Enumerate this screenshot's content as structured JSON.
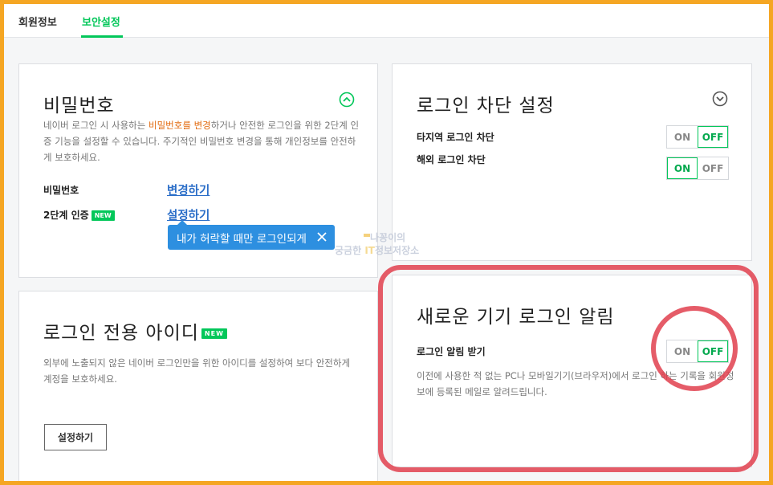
{
  "tabs": {
    "member_info": "회원정보",
    "security": "보안설정"
  },
  "password_card": {
    "title": "비밀번호",
    "desc_pre": "네이버 로그인 시 사용하는 ",
    "desc_highlight": "비밀번호를 변경",
    "desc_post": "하거나 안전한 로그인을 위한 2단계 인증 기능을 설정할 수 있습니다. 주기적인 비밀번호 변경을 통해 개인정보를 안전하게 보호하세요.",
    "rows": [
      {
        "label": "비밀번호",
        "action": "변경하기"
      },
      {
        "label": "2단계 인증",
        "badge": "NEW",
        "action": "설정하기"
      }
    ],
    "tooltip": "내가 허락할 때만 로그인되게",
    "collapse_icon": "chevron-up-circle-icon"
  },
  "block_card": {
    "title": "로그인 차단 설정",
    "expand_icon": "chevron-down-circle-icon",
    "rows": [
      {
        "label": "타지역 로그인 차단",
        "on": "ON",
        "off": "OFF",
        "state": "OFF"
      },
      {
        "label": "해외 로그인 차단",
        "on": "ON",
        "off": "OFF",
        "state": "ON"
      }
    ]
  },
  "id_card": {
    "title": "로그인 전용 아이디",
    "badge": "NEW",
    "desc": "외부에 노출되지 않은 네이버 로그인만을 위한 아이디를 설정하여 보다 안전하게 계정을 보호하세요.",
    "button": "설정하기"
  },
  "alert_card": {
    "title": "새로운 기기 로그인 알림",
    "label": "로그인 알림 받기",
    "on": "ON",
    "off": "OFF",
    "state": "OFF",
    "desc": "이전에 사용한 적 없는 PC나 모바일기기(브라우저)에서 로그인 하는 기록을 회원정보에 등록된 메일로 알려드립니다."
  },
  "watermark": {
    "line1": "나꽁이의",
    "line2_a": "궁금한 ",
    "line2_it": "IT",
    "line2_b": "정보저장소"
  },
  "colors": {
    "accent_green": "#03c75a",
    "link_blue": "#2b6ec8",
    "highlight_orange": "#e26b10",
    "tooltip_blue": "#2d8fe0",
    "annotation_red": "#e0404d",
    "frame_orange": "#f5a623"
  }
}
